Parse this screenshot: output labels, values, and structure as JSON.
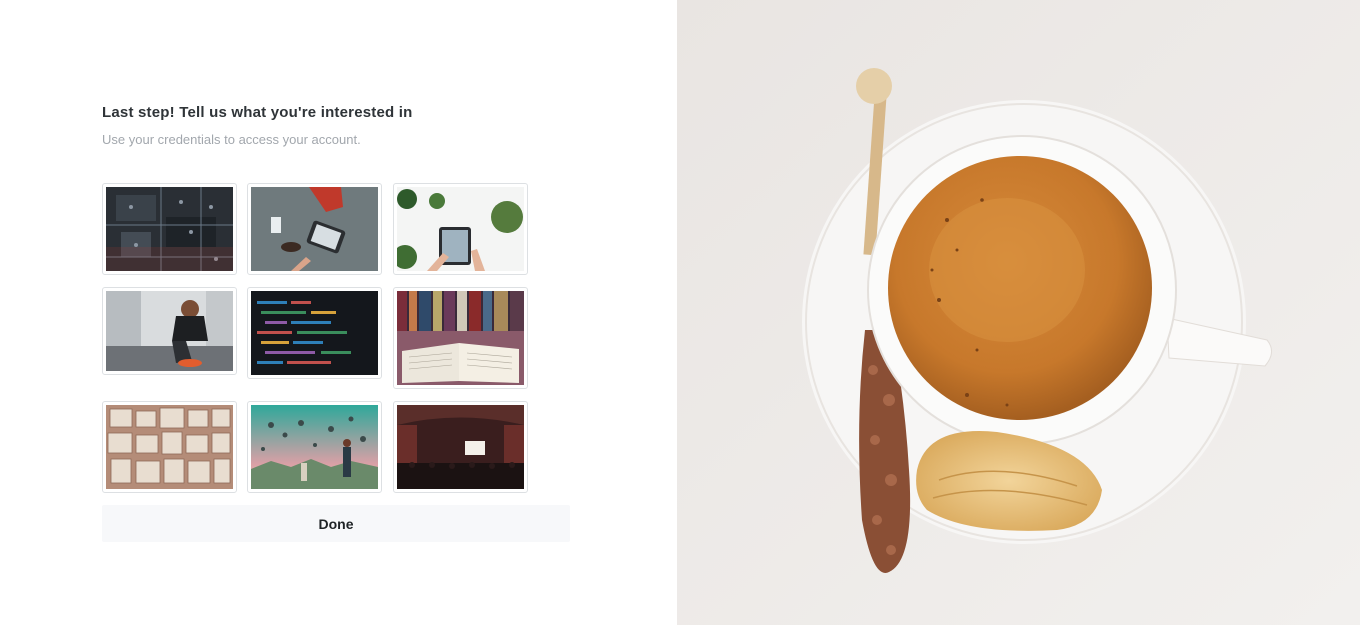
{
  "header": {
    "title": "Last step! Tell us what you're interested in",
    "subtitle": "Use your credentials to access your account."
  },
  "interests": [
    {
      "icon": "circuit-board-photo"
    },
    {
      "icon": "desk-tablet-photo"
    },
    {
      "icon": "tablet-plants-photo"
    },
    {
      "icon": "runner-shoelace-photo"
    },
    {
      "icon": "code-screen-photo"
    },
    {
      "icon": "open-book-photo"
    },
    {
      "icon": "book-pages-photo"
    },
    {
      "icon": "hot-air-balloons-photo"
    },
    {
      "icon": "cinema-hall-photo"
    }
  ],
  "actions": {
    "done_label": "Done"
  },
  "hero": {
    "icon": "coffee-cup-photo"
  }
}
